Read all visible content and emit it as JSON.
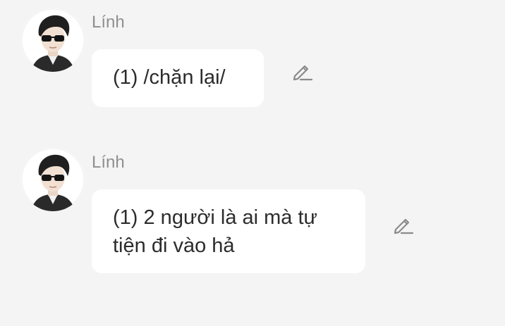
{
  "messages": [
    {
      "sender": "Lính",
      "text": "(1) /chặn lại/",
      "avatar_icon": "avatar-sunglasses-icon",
      "action_icon": "pencil-edit-icon"
    },
    {
      "sender": "Lính",
      "text": "(1) 2 người là ai mà tự tiện đi vào hả",
      "avatar_icon": "avatar-sunglasses-icon",
      "action_icon": "pencil-edit-icon"
    }
  ],
  "colors": {
    "background": "#f4f4f4",
    "bubble": "#ffffff",
    "sender_name": "#8f8f8f",
    "message_text": "#2c2c2c",
    "icon": "#8a8a8a"
  }
}
